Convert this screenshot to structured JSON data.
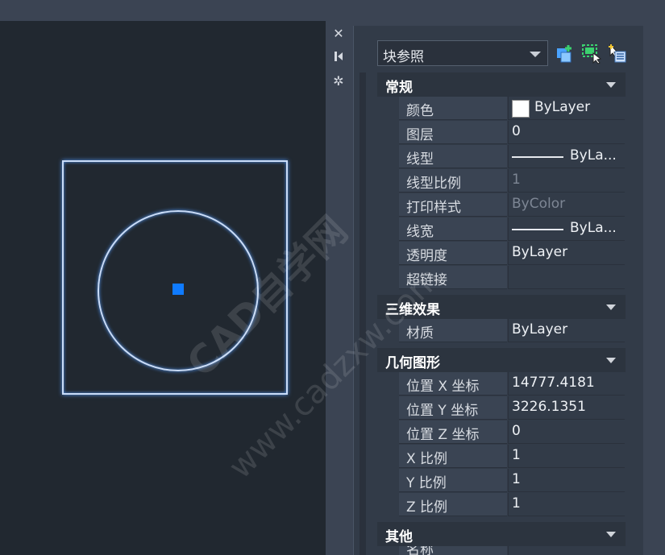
{
  "toolbar": {
    "icons": [
      "close-icon",
      "pin-icon",
      "settings-icon"
    ]
  },
  "selector": {
    "value": "块参照"
  },
  "tool_icons": [
    "quick-select-icon",
    "select-objects-icon",
    "toggle-pickadd-icon"
  ],
  "sections": [
    {
      "title": "常规",
      "rows": [
        {
          "label": "颜色",
          "value": "ByLayer",
          "swatch": "#ffffff"
        },
        {
          "label": "图层",
          "value": "0"
        },
        {
          "label": "线型",
          "value": "ByLa...",
          "line": true
        },
        {
          "label": "线型比例",
          "value": "1",
          "disabled": true
        },
        {
          "label": "打印样式",
          "value": "ByColor",
          "disabled": true
        },
        {
          "label": "线宽",
          "value": "ByLa...",
          "line": true
        },
        {
          "label": "透明度",
          "value": "ByLayer"
        },
        {
          "label": "超链接",
          "value": ""
        }
      ]
    },
    {
      "title": "三维效果",
      "rows": [
        {
          "label": "材质",
          "value": "ByLayer"
        }
      ]
    },
    {
      "title": "几何图形",
      "rows": [
        {
          "label": "位置 X 坐标",
          "value": "14777.4181"
        },
        {
          "label": "位置 Y 坐标",
          "value": "3226.1351"
        },
        {
          "label": "位置 Z 坐标",
          "value": "0"
        },
        {
          "label": "X 比例",
          "value": "1"
        },
        {
          "label": "Y 比例",
          "value": "1"
        },
        {
          "label": "Z 比例",
          "value": "1"
        }
      ]
    },
    {
      "title": "其他",
      "rows": [
        {
          "label": "名称",
          "value": ""
        }
      ]
    }
  ],
  "watermark": {
    "line1": "CAD自学网",
    "line2": "www.cadzxw.com"
  },
  "colors": {
    "selection": "#c9dcf8",
    "grip": "#0f7bff",
    "canvas": "#212830"
  }
}
